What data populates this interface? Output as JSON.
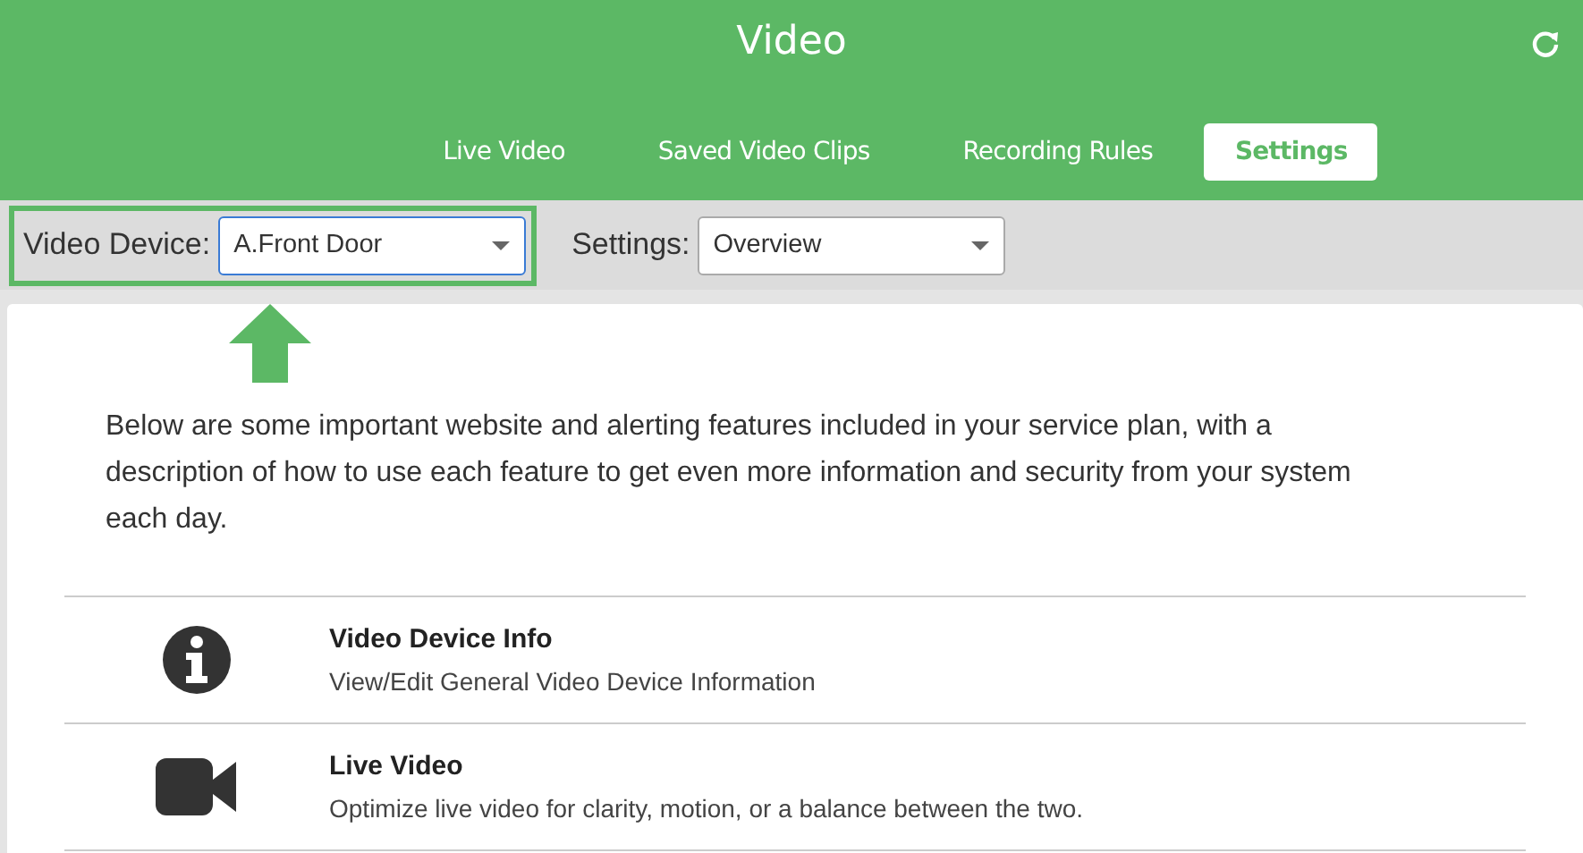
{
  "header": {
    "title": "Video"
  },
  "tabs": [
    {
      "label": "Live Video",
      "selected": false
    },
    {
      "label": "Saved Video Clips",
      "selected": false
    },
    {
      "label": "Recording Rules",
      "selected": false
    },
    {
      "label": "Settings",
      "selected": true
    }
  ],
  "toolbar": {
    "selectors": [
      {
        "label": "Video Device:",
        "value": "A.Front Door",
        "highlighted": true
      },
      {
        "label": "Settings:",
        "value": "Overview",
        "highlighted": false
      }
    ]
  },
  "intro": "Below are some important website and alerting features included in your service plan, with a description of how to use each feature to get even more information and security from your system each day.",
  "features": [
    {
      "kind": "info",
      "title": "Video Device Info",
      "description": "View/Edit General Video Device Information"
    },
    {
      "kind": "video",
      "title": "Live Video",
      "description": "Optimize live video for clarity, motion, or a balance between the two."
    }
  ]
}
